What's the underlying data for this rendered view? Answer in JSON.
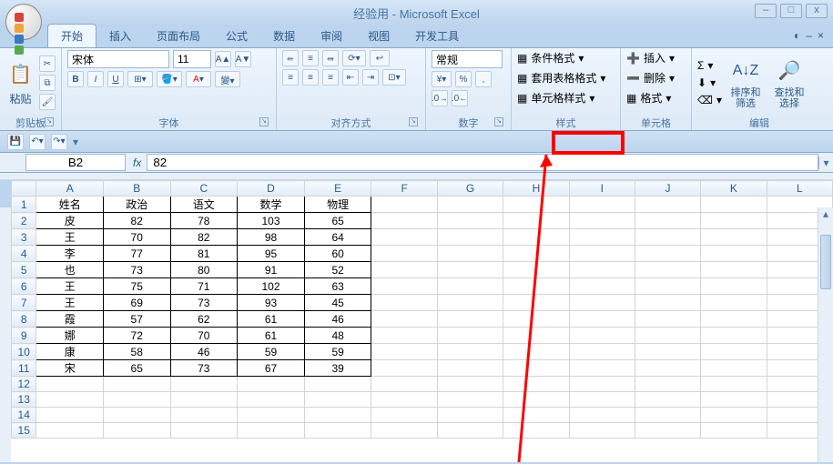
{
  "app": {
    "title": "经验用 - Microsoft Excel"
  },
  "window_controls": {
    "min": "–",
    "max": "□",
    "close": "x"
  },
  "tabs": [
    "开始",
    "插入",
    "页面布局",
    "公式",
    "数据",
    "审阅",
    "视图",
    "开发工具"
  ],
  "active_tab": "开始",
  "ribbon": {
    "clipboard": {
      "paste": "粘贴",
      "label": "剪贴板"
    },
    "font": {
      "name": "宋体",
      "size": "11",
      "label": "字体",
      "bold": "B",
      "italic": "I",
      "underline": "U"
    },
    "align": {
      "label": "对齐方式"
    },
    "number": {
      "format": "常规",
      "percent": "%",
      "thousand": ",",
      "label": "数字"
    },
    "styles": {
      "cond": "条件格式",
      "table": "套用表格格式",
      "cell": "单元格样式",
      "label": "样式"
    },
    "cells": {
      "insert": "插入",
      "delete": "删除",
      "format": "格式",
      "label": "单元格"
    },
    "editing": {
      "sort": "排序和\n筛选",
      "find": "查找和\n选择",
      "sigma": "Σ",
      "label": "编辑"
    }
  },
  "name_box": "B2",
  "formula": "82",
  "chart_data": {
    "type": "table",
    "columns": [
      "A",
      "B",
      "C",
      "D",
      "E",
      "F",
      "G",
      "H",
      "I",
      "J",
      "K",
      "L"
    ],
    "headers_row": [
      "姓名",
      "政治",
      "语文",
      "数学",
      "物理"
    ],
    "rows": [
      [
        "皮",
        "82",
        "78",
        "103",
        "65"
      ],
      [
        "王",
        "70",
        "82",
        "98",
        "64"
      ],
      [
        "李",
        "77",
        "81",
        "95",
        "60"
      ],
      [
        "也",
        "73",
        "80",
        "91",
        "52"
      ],
      [
        "王",
        "75",
        "71",
        "102",
        "63"
      ],
      [
        "王",
        "69",
        "73",
        "93",
        "45"
      ],
      [
        "霞",
        "57",
        "62",
        "61",
        "46"
      ],
      [
        "娜",
        "72",
        "70",
        "61",
        "48"
      ],
      [
        "康",
        "58",
        "46",
        "59",
        "59"
      ],
      [
        "宋",
        "65",
        "73",
        "67",
        "39"
      ]
    ]
  }
}
